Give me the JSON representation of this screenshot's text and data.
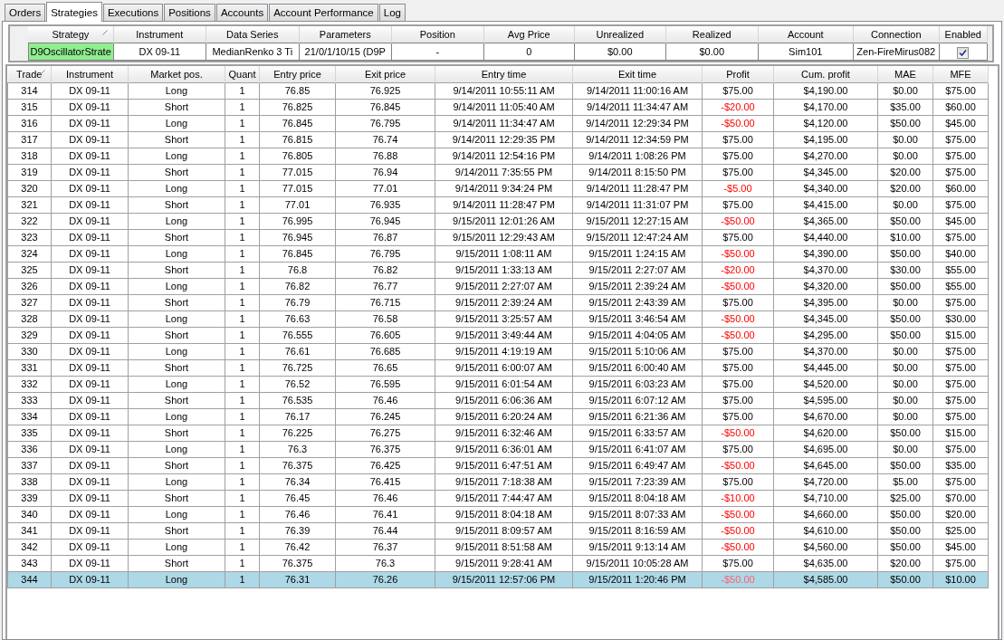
{
  "tabs": [
    {
      "label": "Orders",
      "selected": false
    },
    {
      "label": "Strategies",
      "selected": true
    },
    {
      "label": "Executions",
      "selected": false
    },
    {
      "label": "Positions",
      "selected": false
    },
    {
      "label": "Accounts",
      "selected": false
    },
    {
      "label": "Account Performance",
      "selected": false
    },
    {
      "label": "Log",
      "selected": false
    }
  ],
  "strategy_table": {
    "columns": [
      {
        "label": "Strategy",
        "sorted": true
      },
      {
        "label": "Instrument",
        "sorted": false
      },
      {
        "label": "Data Series",
        "sorted": false
      },
      {
        "label": "Parameters",
        "sorted": false
      },
      {
        "label": "Position",
        "sorted": false
      },
      {
        "label": "Avg Price",
        "sorted": false
      },
      {
        "label": "Unrealized",
        "sorted": false
      },
      {
        "label": "Realized",
        "sorted": false
      },
      {
        "label": "Account",
        "sorted": false
      },
      {
        "label": "Connection",
        "sorted": false
      },
      {
        "label": "Enabled",
        "sorted": false
      }
    ],
    "rows": [
      {
        "strategy": "D9OscillatorStrate",
        "running": true,
        "instrument": "DX 09-11",
        "data_series": "MedianRenko 3 Ti",
        "parameters": "21/0/1/10/15 (D9P",
        "position": "-",
        "avg_price": "0",
        "unrealized": "$0.00",
        "realized": "$0.00",
        "account": "Sim101",
        "connection": "Zen-FireMirus082",
        "enabled": true
      }
    ]
  },
  "trades_table": {
    "columns": [
      {
        "label": "Trade",
        "sorted": true
      },
      {
        "label": "Instrument",
        "sorted": false
      },
      {
        "label": "Market pos.",
        "sorted": false
      },
      {
        "label": "Quant",
        "sorted": false
      },
      {
        "label": "Entry price",
        "sorted": false
      },
      {
        "label": "Exit price",
        "sorted": false
      },
      {
        "label": "Entry time",
        "sorted": false
      },
      {
        "label": "Exit time",
        "sorted": false
      },
      {
        "label": "Profit",
        "sorted": false
      },
      {
        "label": "Cum. profit",
        "sorted": false
      },
      {
        "label": "MAE",
        "sorted": false
      },
      {
        "label": "MFE",
        "sorted": false
      }
    ],
    "rows": [
      {
        "trade": "314",
        "instrument": "DX 09-11",
        "market_pos": "Long",
        "quantity": "1",
        "entry_price": "76.85",
        "exit_price": "76.925",
        "entry_time": "9/14/2011 10:55:11 AM",
        "exit_time": "9/14/2011 11:00:16 AM",
        "profit": "$75.00",
        "loss": false,
        "cum_profit": "$4,190.00",
        "mae": "$0.00",
        "mfe": "$75.00",
        "selected": false
      },
      {
        "trade": "315",
        "instrument": "DX 09-11",
        "market_pos": "Short",
        "quantity": "1",
        "entry_price": "76.825",
        "exit_price": "76.845",
        "entry_time": "9/14/2011 11:05:40 AM",
        "exit_time": "9/14/2011 11:34:47 AM",
        "profit": "-$20.00",
        "loss": true,
        "cum_profit": "$4,170.00",
        "mae": "$35.00",
        "mfe": "$60.00",
        "selected": false
      },
      {
        "trade": "316",
        "instrument": "DX 09-11",
        "market_pos": "Long",
        "quantity": "1",
        "entry_price": "76.845",
        "exit_price": "76.795",
        "entry_time": "9/14/2011 11:34:47 AM",
        "exit_time": "9/14/2011 12:29:34 PM",
        "profit": "-$50.00",
        "loss": true,
        "cum_profit": "$4,120.00",
        "mae": "$50.00",
        "mfe": "$45.00",
        "selected": false
      },
      {
        "trade": "317",
        "instrument": "DX 09-11",
        "market_pos": "Short",
        "quantity": "1",
        "entry_price": "76.815",
        "exit_price": "76.74",
        "entry_time": "9/14/2011 12:29:35 PM",
        "exit_time": "9/14/2011 12:34:59 PM",
        "profit": "$75.00",
        "loss": false,
        "cum_profit": "$4,195.00",
        "mae": "$0.00",
        "mfe": "$75.00",
        "selected": false
      },
      {
        "trade": "318",
        "instrument": "DX 09-11",
        "market_pos": "Long",
        "quantity": "1",
        "entry_price": "76.805",
        "exit_price": "76.88",
        "entry_time": "9/14/2011 12:54:16 PM",
        "exit_time": "9/14/2011 1:08:26 PM",
        "profit": "$75.00",
        "loss": false,
        "cum_profit": "$4,270.00",
        "mae": "$0.00",
        "mfe": "$75.00",
        "selected": false
      },
      {
        "trade": "319",
        "instrument": "DX 09-11",
        "market_pos": "Short",
        "quantity": "1",
        "entry_price": "77.015",
        "exit_price": "76.94",
        "entry_time": "9/14/2011 7:35:55 PM",
        "exit_time": "9/14/2011 8:15:50 PM",
        "profit": "$75.00",
        "loss": false,
        "cum_profit": "$4,345.00",
        "mae": "$20.00",
        "mfe": "$75.00",
        "selected": false
      },
      {
        "trade": "320",
        "instrument": "DX 09-11",
        "market_pos": "Long",
        "quantity": "1",
        "entry_price": "77.015",
        "exit_price": "77.01",
        "entry_time": "9/14/2011 9:34:24 PM",
        "exit_time": "9/14/2011 11:28:47 PM",
        "profit": "-$5.00",
        "loss": true,
        "cum_profit": "$4,340.00",
        "mae": "$20.00",
        "mfe": "$60.00",
        "selected": false
      },
      {
        "trade": "321",
        "instrument": "DX 09-11",
        "market_pos": "Short",
        "quantity": "1",
        "entry_price": "77.01",
        "exit_price": "76.935",
        "entry_time": "9/14/2011 11:28:47 PM",
        "exit_time": "9/14/2011 11:31:07 PM",
        "profit": "$75.00",
        "loss": false,
        "cum_profit": "$4,415.00",
        "mae": "$0.00",
        "mfe": "$75.00",
        "selected": false
      },
      {
        "trade": "322",
        "instrument": "DX 09-11",
        "market_pos": "Long",
        "quantity": "1",
        "entry_price": "76.995",
        "exit_price": "76.945",
        "entry_time": "9/15/2011 12:01:26 AM",
        "exit_time": "9/15/2011 12:27:15 AM",
        "profit": "-$50.00",
        "loss": true,
        "cum_profit": "$4,365.00",
        "mae": "$50.00",
        "mfe": "$45.00",
        "selected": false
      },
      {
        "trade": "323",
        "instrument": "DX 09-11",
        "market_pos": "Short",
        "quantity": "1",
        "entry_price": "76.945",
        "exit_price": "76.87",
        "entry_time": "9/15/2011 12:29:43 AM",
        "exit_time": "9/15/2011 12:47:24 AM",
        "profit": "$75.00",
        "loss": false,
        "cum_profit": "$4,440.00",
        "mae": "$10.00",
        "mfe": "$75.00",
        "selected": false
      },
      {
        "trade": "324",
        "instrument": "DX 09-11",
        "market_pos": "Long",
        "quantity": "1",
        "entry_price": "76.845",
        "exit_price": "76.795",
        "entry_time": "9/15/2011 1:08:11 AM",
        "exit_time": "9/15/2011 1:24:15 AM",
        "profit": "-$50.00",
        "loss": true,
        "cum_profit": "$4,390.00",
        "mae": "$50.00",
        "mfe": "$40.00",
        "selected": false
      },
      {
        "trade": "325",
        "instrument": "DX 09-11",
        "market_pos": "Short",
        "quantity": "1",
        "entry_price": "76.8",
        "exit_price": "76.82",
        "entry_time": "9/15/2011 1:33:13 AM",
        "exit_time": "9/15/2011 2:27:07 AM",
        "profit": "-$20.00",
        "loss": true,
        "cum_profit": "$4,370.00",
        "mae": "$30.00",
        "mfe": "$55.00",
        "selected": false
      },
      {
        "trade": "326",
        "instrument": "DX 09-11",
        "market_pos": "Long",
        "quantity": "1",
        "entry_price": "76.82",
        "exit_price": "76.77",
        "entry_time": "9/15/2011 2:27:07 AM",
        "exit_time": "9/15/2011 2:39:24 AM",
        "profit": "-$50.00",
        "loss": true,
        "cum_profit": "$4,320.00",
        "mae": "$50.00",
        "mfe": "$55.00",
        "selected": false
      },
      {
        "trade": "327",
        "instrument": "DX 09-11",
        "market_pos": "Short",
        "quantity": "1",
        "entry_price": "76.79",
        "exit_price": "76.715",
        "entry_time": "9/15/2011 2:39:24 AM",
        "exit_time": "9/15/2011 2:43:39 AM",
        "profit": "$75.00",
        "loss": false,
        "cum_profit": "$4,395.00",
        "mae": "$0.00",
        "mfe": "$75.00",
        "selected": false
      },
      {
        "trade": "328",
        "instrument": "DX 09-11",
        "market_pos": "Long",
        "quantity": "1",
        "entry_price": "76.63",
        "exit_price": "76.58",
        "entry_time": "9/15/2011 3:25:57 AM",
        "exit_time": "9/15/2011 3:46:54 AM",
        "profit": "-$50.00",
        "loss": true,
        "cum_profit": "$4,345.00",
        "mae": "$50.00",
        "mfe": "$30.00",
        "selected": false
      },
      {
        "trade": "329",
        "instrument": "DX 09-11",
        "market_pos": "Short",
        "quantity": "1",
        "entry_price": "76.555",
        "exit_price": "76.605",
        "entry_time": "9/15/2011 3:49:44 AM",
        "exit_time": "9/15/2011 4:04:05 AM",
        "profit": "-$50.00",
        "loss": true,
        "cum_profit": "$4,295.00",
        "mae": "$50.00",
        "mfe": "$15.00",
        "selected": false
      },
      {
        "trade": "330",
        "instrument": "DX 09-11",
        "market_pos": "Long",
        "quantity": "1",
        "entry_price": "76.61",
        "exit_price": "76.685",
        "entry_time": "9/15/2011 4:19:19 AM",
        "exit_time": "9/15/2011 5:10:06 AM",
        "profit": "$75.00",
        "loss": false,
        "cum_profit": "$4,370.00",
        "mae": "$0.00",
        "mfe": "$75.00",
        "selected": false
      },
      {
        "trade": "331",
        "instrument": "DX 09-11",
        "market_pos": "Short",
        "quantity": "1",
        "entry_price": "76.725",
        "exit_price": "76.65",
        "entry_time": "9/15/2011 6:00:07 AM",
        "exit_time": "9/15/2011 6:00:40 AM",
        "profit": "$75.00",
        "loss": false,
        "cum_profit": "$4,445.00",
        "mae": "$0.00",
        "mfe": "$75.00",
        "selected": false
      },
      {
        "trade": "332",
        "instrument": "DX 09-11",
        "market_pos": "Long",
        "quantity": "1",
        "entry_price": "76.52",
        "exit_price": "76.595",
        "entry_time": "9/15/2011 6:01:54 AM",
        "exit_time": "9/15/2011 6:03:23 AM",
        "profit": "$75.00",
        "loss": false,
        "cum_profit": "$4,520.00",
        "mae": "$0.00",
        "mfe": "$75.00",
        "selected": false
      },
      {
        "trade": "333",
        "instrument": "DX 09-11",
        "market_pos": "Short",
        "quantity": "1",
        "entry_price": "76.535",
        "exit_price": "76.46",
        "entry_time": "9/15/2011 6:06:36 AM",
        "exit_time": "9/15/2011 6:07:12 AM",
        "profit": "$75.00",
        "loss": false,
        "cum_profit": "$4,595.00",
        "mae": "$0.00",
        "mfe": "$75.00",
        "selected": false
      },
      {
        "trade": "334",
        "instrument": "DX 09-11",
        "market_pos": "Long",
        "quantity": "1",
        "entry_price": "76.17",
        "exit_price": "76.245",
        "entry_time": "9/15/2011 6:20:24 AM",
        "exit_time": "9/15/2011 6:21:36 AM",
        "profit": "$75.00",
        "loss": false,
        "cum_profit": "$4,670.00",
        "mae": "$0.00",
        "mfe": "$75.00",
        "selected": false
      },
      {
        "trade": "335",
        "instrument": "DX 09-11",
        "market_pos": "Short",
        "quantity": "1",
        "entry_price": "76.225",
        "exit_price": "76.275",
        "entry_time": "9/15/2011 6:32:46 AM",
        "exit_time": "9/15/2011 6:33:57 AM",
        "profit": "-$50.00",
        "loss": true,
        "cum_profit": "$4,620.00",
        "mae": "$50.00",
        "mfe": "$15.00",
        "selected": false
      },
      {
        "trade": "336",
        "instrument": "DX 09-11",
        "market_pos": "Long",
        "quantity": "1",
        "entry_price": "76.3",
        "exit_price": "76.375",
        "entry_time": "9/15/2011 6:36:01 AM",
        "exit_time": "9/15/2011 6:41:07 AM",
        "profit": "$75.00",
        "loss": false,
        "cum_profit": "$4,695.00",
        "mae": "$0.00",
        "mfe": "$75.00",
        "selected": false
      },
      {
        "trade": "337",
        "instrument": "DX 09-11",
        "market_pos": "Short",
        "quantity": "1",
        "entry_price": "76.375",
        "exit_price": "76.425",
        "entry_time": "9/15/2011 6:47:51 AM",
        "exit_time": "9/15/2011 6:49:47 AM",
        "profit": "-$50.00",
        "loss": true,
        "cum_profit": "$4,645.00",
        "mae": "$50.00",
        "mfe": "$35.00",
        "selected": false
      },
      {
        "trade": "338",
        "instrument": "DX 09-11",
        "market_pos": "Long",
        "quantity": "1",
        "entry_price": "76.34",
        "exit_price": "76.415",
        "entry_time": "9/15/2011 7:18:38 AM",
        "exit_time": "9/15/2011 7:23:39 AM",
        "profit": "$75.00",
        "loss": false,
        "cum_profit": "$4,720.00",
        "mae": "$5.00",
        "mfe": "$75.00",
        "selected": false
      },
      {
        "trade": "339",
        "instrument": "DX 09-11",
        "market_pos": "Short",
        "quantity": "1",
        "entry_price": "76.45",
        "exit_price": "76.46",
        "entry_time": "9/15/2011 7:44:47 AM",
        "exit_time": "9/15/2011 8:04:18 AM",
        "profit": "-$10.00",
        "loss": true,
        "cum_profit": "$4,710.00",
        "mae": "$25.00",
        "mfe": "$70.00",
        "selected": false
      },
      {
        "trade": "340",
        "instrument": "DX 09-11",
        "market_pos": "Long",
        "quantity": "1",
        "entry_price": "76.46",
        "exit_price": "76.41",
        "entry_time": "9/15/2011 8:04:18 AM",
        "exit_time": "9/15/2011 8:07:33 AM",
        "profit": "-$50.00",
        "loss": true,
        "cum_profit": "$4,660.00",
        "mae": "$50.00",
        "mfe": "$20.00",
        "selected": false
      },
      {
        "trade": "341",
        "instrument": "DX 09-11",
        "market_pos": "Short",
        "quantity": "1",
        "entry_price": "76.39",
        "exit_price": "76.44",
        "entry_time": "9/15/2011 8:09:57 AM",
        "exit_time": "9/15/2011 8:16:59 AM",
        "profit": "-$50.00",
        "loss": true,
        "cum_profit": "$4,610.00",
        "mae": "$50.00",
        "mfe": "$25.00",
        "selected": false
      },
      {
        "trade": "342",
        "instrument": "DX 09-11",
        "market_pos": "Long",
        "quantity": "1",
        "entry_price": "76.42",
        "exit_price": "76.37",
        "entry_time": "9/15/2011 8:51:58 AM",
        "exit_time": "9/15/2011 9:13:14 AM",
        "profit": "-$50.00",
        "loss": true,
        "cum_profit": "$4,560.00",
        "mae": "$50.00",
        "mfe": "$45.00",
        "selected": false
      },
      {
        "trade": "343",
        "instrument": "DX 09-11",
        "market_pos": "Short",
        "quantity": "1",
        "entry_price": "76.375",
        "exit_price": "76.3",
        "entry_time": "9/15/2011 9:28:41 AM",
        "exit_time": "9/15/2011 10:05:28 AM",
        "profit": "$75.00",
        "loss": false,
        "cum_profit": "$4,635.00",
        "mae": "$20.00",
        "mfe": "$75.00",
        "selected": false
      },
      {
        "trade": "344",
        "instrument": "DX 09-11",
        "market_pos": "Long",
        "quantity": "1",
        "entry_price": "76.31",
        "exit_price": "76.26",
        "entry_time": "9/15/2011 12:57:06 PM",
        "exit_time": "9/15/2011 1:20:46 PM",
        "profit": "-$50.00",
        "loss": true,
        "cum_profit": "$4,585.00",
        "mae": "$50.00",
        "mfe": "$10.00",
        "selected": true
      }
    ]
  }
}
